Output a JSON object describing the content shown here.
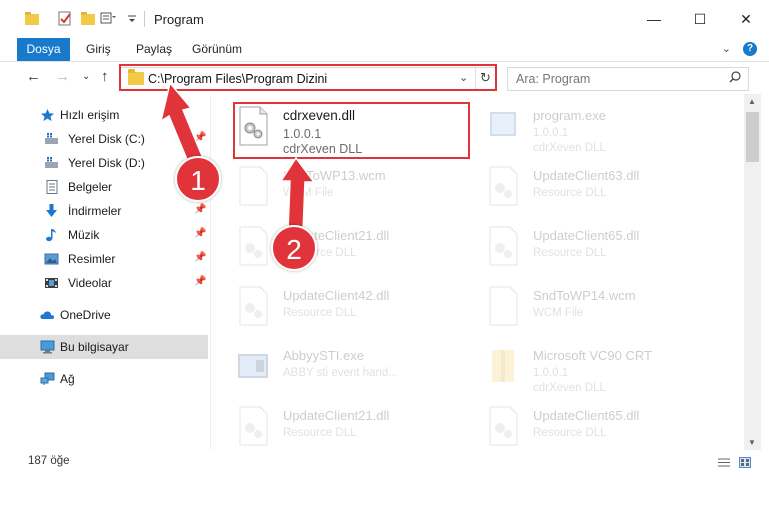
{
  "window": {
    "title": "Program",
    "minimize_glyph": "—",
    "maximize_glyph": "☐",
    "close_glyph": "✕"
  },
  "ribbon": {
    "tabs": [
      "Dosya",
      "Giriş",
      "Paylaş",
      "Görünüm"
    ],
    "collapse_glyph": "⌄",
    "help_glyph": "?"
  },
  "navigation": {
    "back_glyph": "←",
    "forward_glyph": "→",
    "recent_glyph": "⌄",
    "up_glyph": "↑",
    "address_path": "C:\\Program Files\\Program Dizini",
    "address_dropdown_glyph": "⌄",
    "refresh_glyph": "↻",
    "search_placeholder": "Ara: Program"
  },
  "sidebar": {
    "quick_access": "Hızlı erişim",
    "items": [
      {
        "label": "Yerel Disk (C:)",
        "icon": "drive-icon",
        "pinned": true
      },
      {
        "label": "Yerel Disk (D:)",
        "icon": "drive-icon",
        "pinned": false
      },
      {
        "label": "Belgeler",
        "icon": "documents-icon",
        "pinned": false
      },
      {
        "label": "İndirmeler",
        "icon": "downloads-icon",
        "pinned": true
      },
      {
        "label": "Müzik",
        "icon": "music-icon",
        "pinned": true
      },
      {
        "label": "Resimler",
        "icon": "pictures-icon",
        "pinned": true
      },
      {
        "label": "Videolar",
        "icon": "videos-icon",
        "pinned": true
      }
    ],
    "onedrive": "OneDrive",
    "this_pc": "Bu bilgisayar",
    "network": "Ağ",
    "pin_glyph": "📌"
  },
  "files": [
    {
      "name": "cdrxeven.dll",
      "line2": "1.0.0.1",
      "line3": "cdrXeven DLL",
      "icon": "dll-icon",
      "highlighted": true
    },
    {
      "name": "program.exe",
      "line2": "1.0.0.1",
      "line3": "cdrXeven DLL",
      "icon": "exe-icon",
      "highlighted": false
    },
    {
      "name": "SndToWP13.wcm",
      "line2": "WCM File",
      "line3": "",
      "icon": "file-icon",
      "highlighted": false
    },
    {
      "name": "UpdateClient63.dll",
      "line2": "Resource DLL",
      "line3": "",
      "icon": "dll-icon",
      "highlighted": false
    },
    {
      "name": "UpdateClient21.dll",
      "line2": "Resource DLL",
      "line3": "",
      "icon": "dll-icon",
      "highlighted": false
    },
    {
      "name": "UpdateClient65.dll",
      "line2": "Resource DLL",
      "line3": "",
      "icon": "dll-icon",
      "highlighted": false
    },
    {
      "name": "UpdateClient42.dll",
      "line2": "Resource DLL",
      "line3": "",
      "icon": "dll-icon",
      "highlighted": false
    },
    {
      "name": "SndToWP14.wcm",
      "line2": "WCM File",
      "line3": "",
      "icon": "file-icon",
      "highlighted": false
    },
    {
      "name": "AbbyySTI.exe",
      "line2": "ABBY sti event hand...",
      "line3": "",
      "icon": "exe-icon",
      "highlighted": false
    },
    {
      "name": "Microsoft VC90 CRT",
      "line2": "1.0.0.1",
      "line3": "cdrXeven DLL",
      "icon": "zip-folder-icon",
      "highlighted": false
    },
    {
      "name": "UpdateClient21.dll",
      "line2": "Resource DLL",
      "line3": "",
      "icon": "dll-icon",
      "highlighted": false
    },
    {
      "name": "UpdateClient65.dll",
      "line2": "Resource DLL",
      "line3": "",
      "icon": "dll-icon",
      "highlighted": false
    }
  ],
  "status": {
    "item_count": "187 öğe"
  },
  "annotations": {
    "step1": "1",
    "step2": "2",
    "color": "#e0343a"
  },
  "colors": {
    "accent": "#1979ca",
    "folder": "#f3c948"
  }
}
